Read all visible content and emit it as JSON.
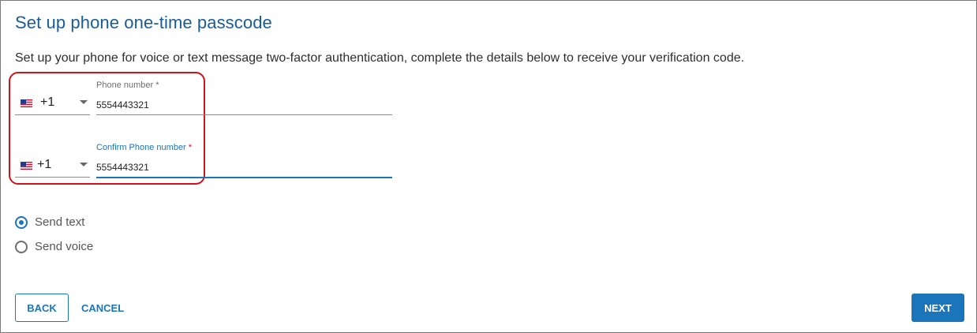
{
  "page": {
    "title": "Set up phone one-time passcode",
    "description": "Set up your phone for voice or text message two-factor authentication, complete the details below to receive your verification code."
  },
  "phone": {
    "country_flag_icon": "us-flag-icon",
    "country_code": "+1",
    "label": "Phone number",
    "required_mark": "*",
    "value": "5554443321"
  },
  "confirm_phone": {
    "country_flag_icon": "us-flag-icon",
    "country_code": "+1",
    "label": "Confirm Phone number",
    "required_mark": "*",
    "value": "5554443321"
  },
  "delivery": {
    "options": [
      {
        "label": "Send text",
        "selected": true
      },
      {
        "label": "Send voice",
        "selected": false
      }
    ]
  },
  "actions": {
    "back_label": "BACK",
    "cancel_label": "CANCEL",
    "next_label": "NEXT"
  },
  "colors": {
    "accent": "#1a75bb",
    "title": "#1a5c96",
    "highlight": "#d0131a"
  }
}
